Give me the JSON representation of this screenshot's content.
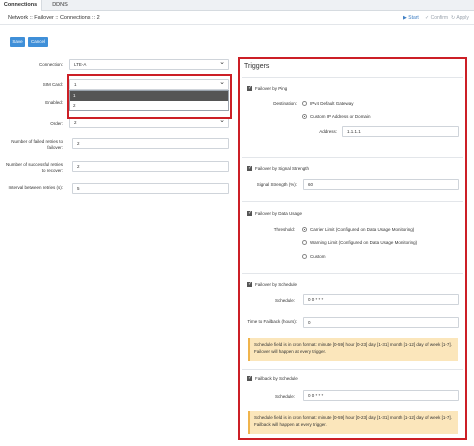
{
  "tabs": [
    {
      "label": "Connections",
      "active": true
    },
    {
      "label": "DDNS",
      "active": false
    }
  ],
  "breadcrumb": "Network :: Failover :: Connections :: 2",
  "header_actions": {
    "start": "Start",
    "confirm": "Confirm",
    "apply": "Apply"
  },
  "form_buttons": {
    "save": "Save",
    "cancel": "Cancel"
  },
  "left_form": {
    "connection": {
      "label": "Connection:",
      "value": "LTE-A"
    },
    "sim_card": {
      "label": "SIM Card:",
      "value": "1",
      "options": [
        "1",
        "2"
      ],
      "selected_option": "1"
    },
    "enabled": {
      "label": "Enabled:"
    },
    "order": {
      "label": "Order:",
      "value": "2"
    },
    "failed_retries": {
      "label": "Number of failed retries to failover:",
      "value": "2"
    },
    "successful_retries": {
      "label": "Number of successful retries to recover:",
      "value": "2"
    },
    "interval": {
      "label": "Interval between retries (s):",
      "value": "5"
    }
  },
  "triggers": {
    "title": "Triggers",
    "ping": {
      "label": "Failover by Ping",
      "checked": true,
      "destination_label": "Destination:",
      "option_ipv4": "IPv4 Default Gateway",
      "option_custom": "Custom IP Address or Domain",
      "address_label": "Address:",
      "address_value": "1.1.1.1"
    },
    "signal": {
      "label": "Failover by Signal Strength",
      "checked": true,
      "strength_label": "Signal Strength (%):",
      "strength_value": "60"
    },
    "data_usage": {
      "label": "Failover by Data Usage",
      "checked": true,
      "threshold_label": "Threshold:",
      "option_carrier": "Carrier Limit (Configured on Data Usage Monitoring)",
      "option_warning": "Warning Limit (Configured on Data Usage Monitoring)",
      "option_custom": "Custom"
    },
    "schedule": {
      "label": "Failover by Schedule",
      "checked": true,
      "schedule_label": "Schedule:",
      "schedule_value": "0 0 * * *",
      "time_label": "Time to Failback (hours):",
      "time_value": "0",
      "note": "Schedule field is in cron format: minute [0-59] hour [0-23] day [1-31] month [1-12] day of week [1-7]. Failover will happen at every trigger."
    },
    "failback": {
      "label": "Failback by Schedule",
      "checked": true,
      "schedule_label": "Schedule:",
      "schedule_value": "0 0 * * *",
      "note": "Schedule field is in cron format: minute [0-59] hour [0-23] day [1-31] month [1-12] day of week [1-7]. Failback will happen at every trigger."
    }
  },
  "colors": {
    "accent": "#3f8fd8",
    "highlight": "#cc1f26",
    "note_bg": "#fbe6bb"
  }
}
